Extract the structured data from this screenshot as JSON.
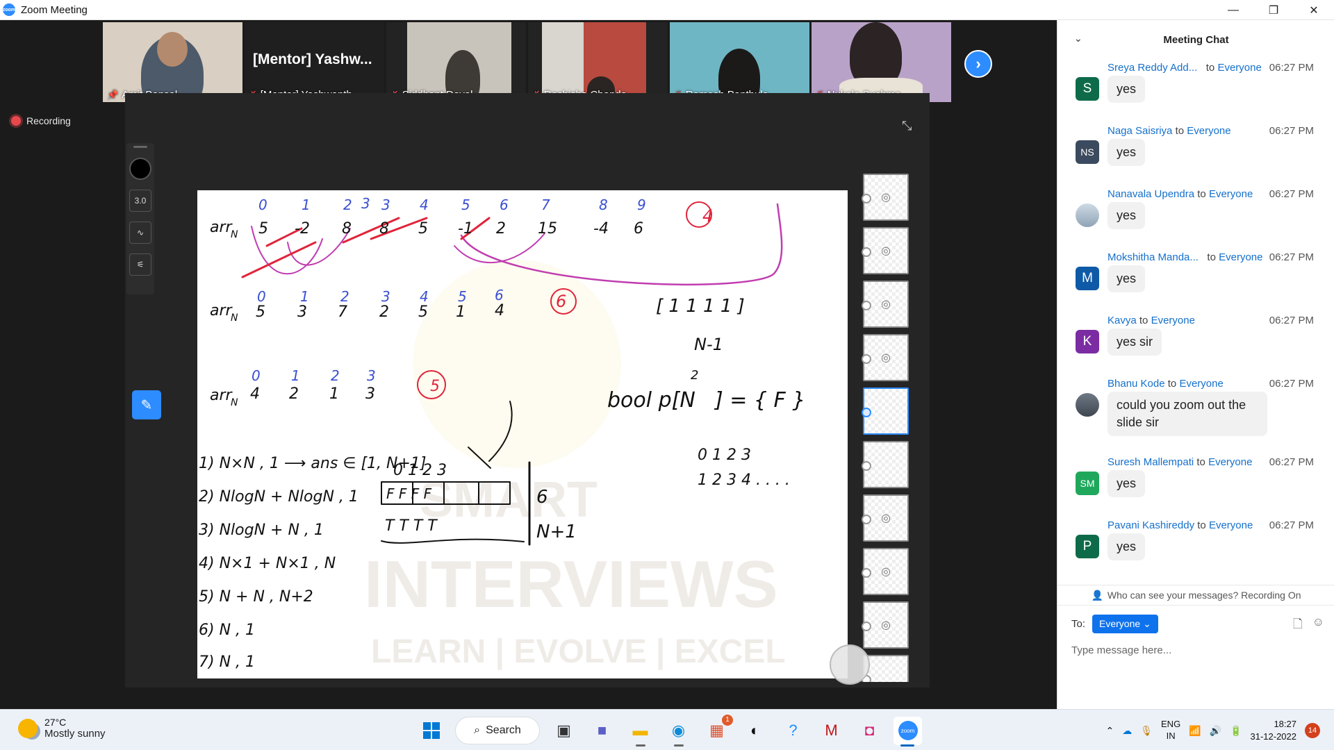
{
  "window": {
    "title": "Zoom Meeting",
    "controls": [
      "—",
      "❐",
      "✕"
    ]
  },
  "gallery": {
    "participants": [
      {
        "name": "Amit Bansal",
        "mic": "pin",
        "active": true,
        "bg": "#d9cfc2",
        "person": "#4c5a6a"
      },
      {
        "name": "[Mentor] Yashwanth",
        "display_title": "[Mentor]  Yashw...",
        "mic": "off",
        "active": false,
        "bg": "#1f1f1f",
        "person": null
      },
      {
        "name": "Siddhant Dayal",
        "mic": "off",
        "active": false,
        "bg": "#c9c4bb",
        "person": "#3e3a36"
      },
      {
        "name": "Rochisha Chanda",
        "mic": "off",
        "active": false,
        "bg": "#b84a3f",
        "person": "#2a2422"
      },
      {
        "name": "Ramesh Panthula",
        "mic": "off",
        "active": false,
        "bg": "#6fb6c4",
        "person": "#1c1a19"
      },
      {
        "name": "Nukala Sushma",
        "mic": "off",
        "active": false,
        "bg": "#b9a2c8",
        "person": "#2c2324"
      }
    ],
    "next_icon": "›"
  },
  "recording": {
    "label": "Recording"
  },
  "annotation_toolbar": {
    "width_label": "3.0"
  },
  "chat": {
    "title": "Meeting Chat",
    "messages": [
      {
        "sender": "Sreya Reddy Add...",
        "to": "Everyone",
        "time": "06:27 PM",
        "avatar": "S",
        "avatar_color": "#0e6b4a",
        "text": "yes"
      },
      {
        "sender": "Naga Saisriya",
        "to": "Everyone",
        "time": "06:27 PM",
        "avatar": "NS",
        "avatar_color": "#3b4a5e",
        "text": "yes"
      },
      {
        "sender": "Nanavala Upendra",
        "to": "Everyone",
        "time": "06:27 PM",
        "avatar": "",
        "avatar_color": "#8fa3b5",
        "text": "yes"
      },
      {
        "sender": "Mokshitha Manda...",
        "to": "Everyone",
        "time": "06:27 PM",
        "avatar": "M",
        "avatar_color": "#0e5aa7",
        "text": "yes"
      },
      {
        "sender": "Kavya",
        "to": "Everyone",
        "time": "06:27 PM",
        "avatar": "K",
        "avatar_color": "#7b2ca3",
        "text": "yes sir"
      },
      {
        "sender": "Bhanu Kode",
        "to": "Everyone",
        "time": "06:27 PM",
        "avatar": "",
        "avatar_color": "#5b6470",
        "text": "could you zoom out the slide sir"
      },
      {
        "sender": "Suresh Mallempati",
        "to": "Everyone",
        "time": "06:27 PM",
        "avatar": "SM",
        "avatar_color": "#1fa85c",
        "text": "yes"
      },
      {
        "sender": "Pavani Kashireddy",
        "to": "Everyone",
        "time": "06:27 PM",
        "avatar": "P",
        "avatar_color": "#0e6b4a",
        "text": "yes"
      }
    ],
    "to_word": "to",
    "privacy_text": "Who can see your messages? Recording On",
    "to_label": "To:",
    "recipient": "Everyone",
    "input_placeholder": "Type message here..."
  },
  "taskbar": {
    "weather_temp": "27°C",
    "weather_desc": "Mostly sunny",
    "search_label": "Search",
    "store_badge": "1",
    "lang_1": "ENG",
    "lang_2": "IN",
    "time": "18:27",
    "date": "31-12-2022",
    "notifications": "14"
  }
}
